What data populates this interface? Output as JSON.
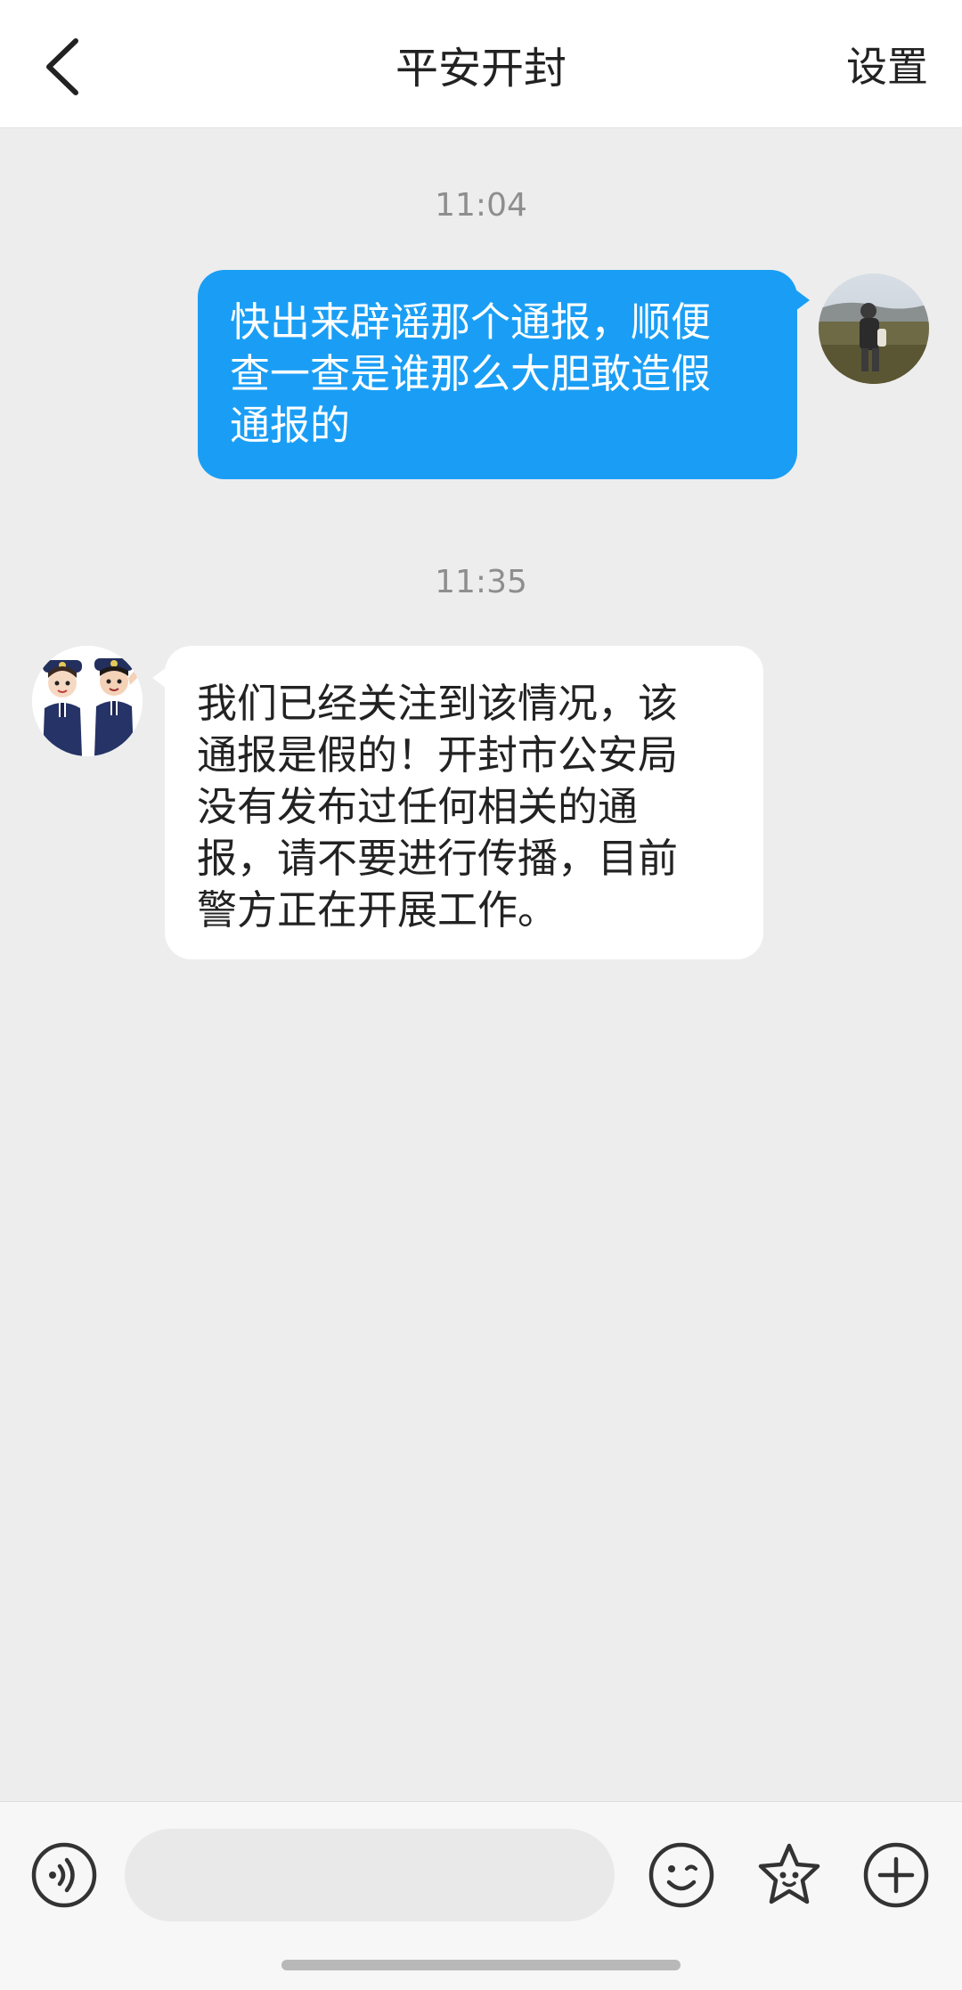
{
  "header": {
    "title": "平安开封",
    "settings_label": "设置",
    "back_icon": "chevron-left-icon"
  },
  "messages": [
    {
      "time": "11:04",
      "direction": "outgoing",
      "text": "快出来辟谣那个通报，顺便\n查一查是谁那么大胆敢造假\n通报的",
      "bubble_color": "#1a9ef5"
    },
    {
      "time": "11:35",
      "direction": "incoming",
      "text": "我们已经关注到该情况，该\n通报是假的！开封市公安局\n没有发布过任何相关的通\n报，请不要进行传播，目前\n警方正在开展工作。",
      "bubble_color": "#ffffff"
    }
  ],
  "input_bar": {
    "voice_icon": "voice-icon",
    "emoji_icon": "smiley-icon",
    "sticker_icon": "star-sticker-icon",
    "plus_icon": "plus-circle-icon"
  },
  "colors": {
    "accent": "#1a9ef5",
    "background": "#ededed"
  }
}
